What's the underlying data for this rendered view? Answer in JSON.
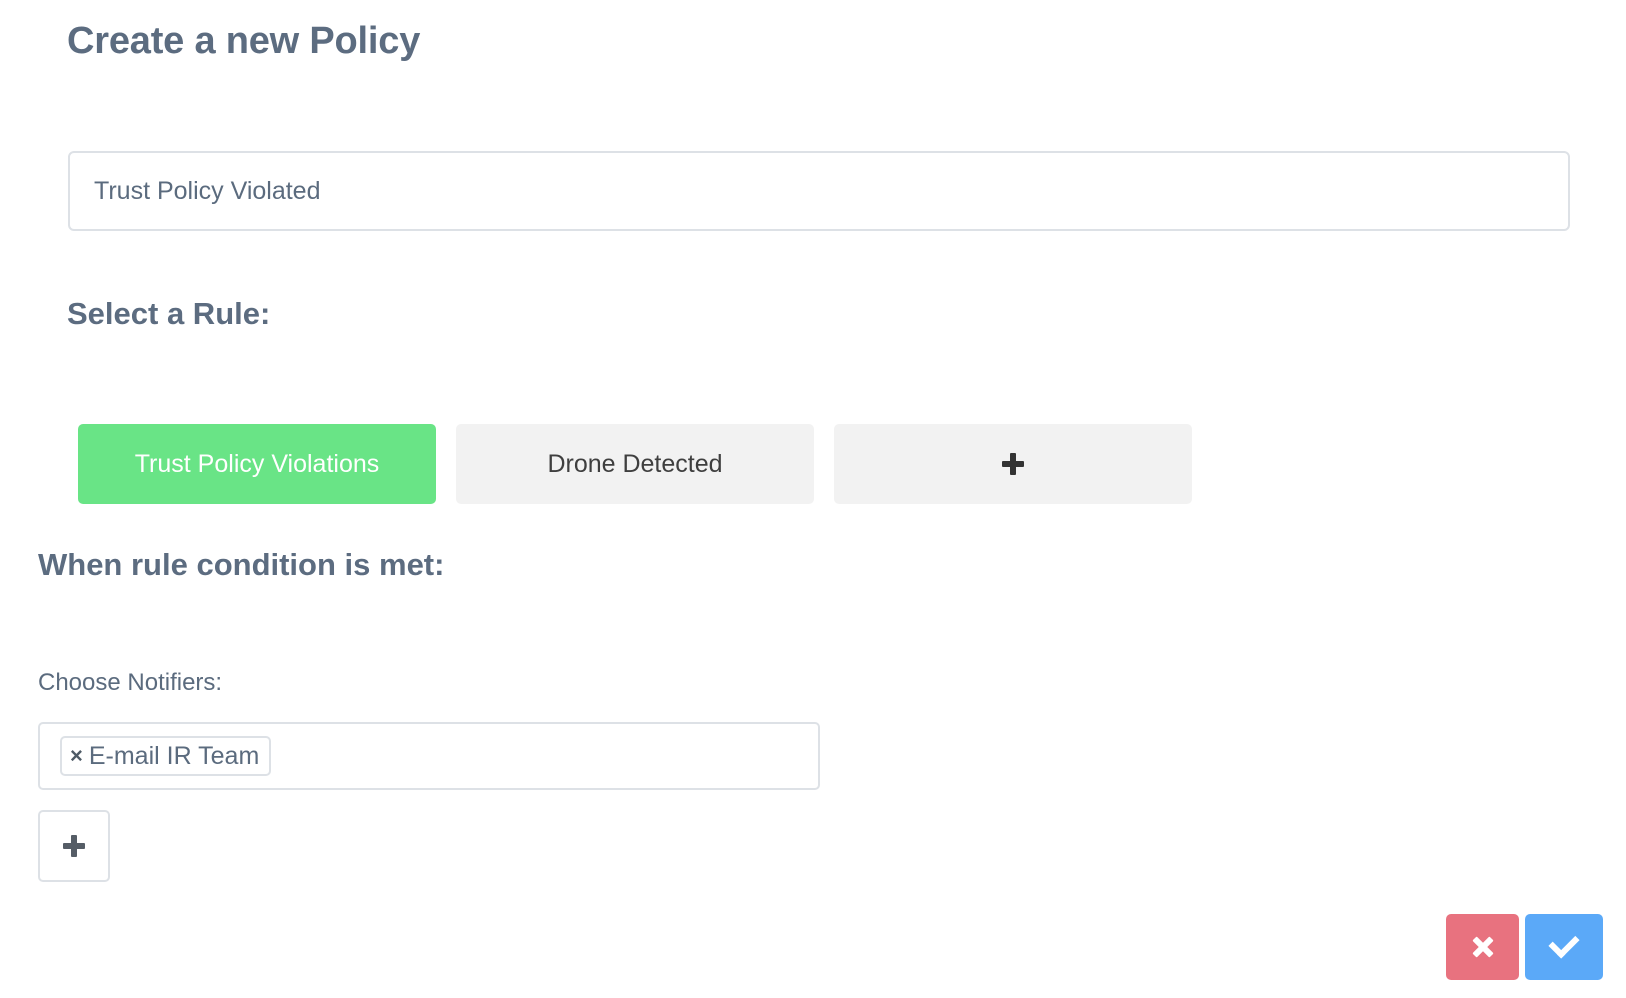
{
  "page": {
    "title": "Create a new Policy"
  },
  "policy_name": {
    "value": "Trust Policy Violated"
  },
  "rule_section": {
    "heading": "Select a Rule:",
    "rules": [
      {
        "label": "Trust Policy Violations",
        "selected": true
      },
      {
        "label": "Drone Detected",
        "selected": false
      }
    ],
    "add_icon": "plus-icon"
  },
  "condition_section": {
    "heading": "When rule condition is met:",
    "notifiers_label": "Choose Notifiers:",
    "notifiers": [
      {
        "label": "E-mail IR Team",
        "remove_symbol": "×"
      }
    ],
    "add_icon": "plus-icon"
  },
  "actions": {
    "cancel_icon": "close-icon",
    "confirm_icon": "check-icon"
  },
  "colors": {
    "selected_rule": "#69e486",
    "cancel": "#e8727f",
    "confirm": "#5ba9f8",
    "text": "#5c6c80"
  }
}
